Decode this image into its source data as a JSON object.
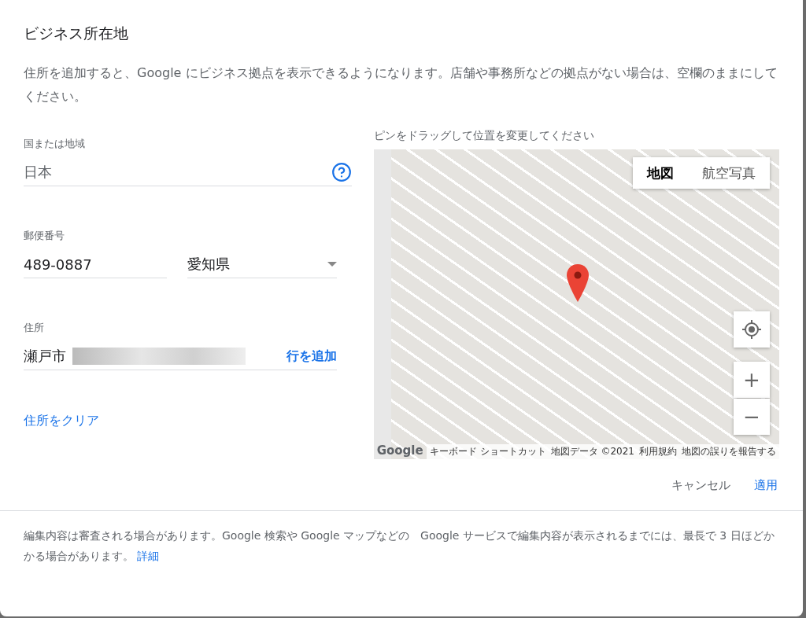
{
  "dialog": {
    "title": "ビジネス所在地",
    "description": "住所を追加すると、Google にビジネス拠点を表示できるようになります。店舗や事務所などの拠点がない場合は、空欄のままにしてください。"
  },
  "form": {
    "country": {
      "label": "国または地域",
      "value": "日本"
    },
    "postal": {
      "label": "郵便番号",
      "value": "489-0887"
    },
    "prefecture": {
      "value": "愛知県"
    },
    "address": {
      "label": "住所",
      "value": "瀬戸市",
      "redacted": true,
      "add_line": "行を追加"
    },
    "clear_link": "住所をクリア"
  },
  "map": {
    "hint": "ピンをドラッグして位置を変更してください",
    "map_types": [
      {
        "label": "地図",
        "selected": true
      },
      {
        "label": "航空写真",
        "selected": false
      }
    ],
    "zoom_in": "+",
    "zoom_out": "−",
    "logo": "Google",
    "footer": [
      "キーボード ショートカット",
      "地図データ ©2021",
      "利用規約",
      "地図の誤りを報告する"
    ]
  },
  "actions": [
    {
      "label": "キャンセル",
      "kind": "secondary"
    },
    {
      "label": "適用",
      "kind": "primary"
    }
  ],
  "notice": {
    "text": "編集内容は審査される場合があります。Google 検索や Google マップなどの　Google サービスで編集内容が表示されるまでには、最長で 3 日ほどかかる場合があります。",
    "link": "詳細"
  }
}
